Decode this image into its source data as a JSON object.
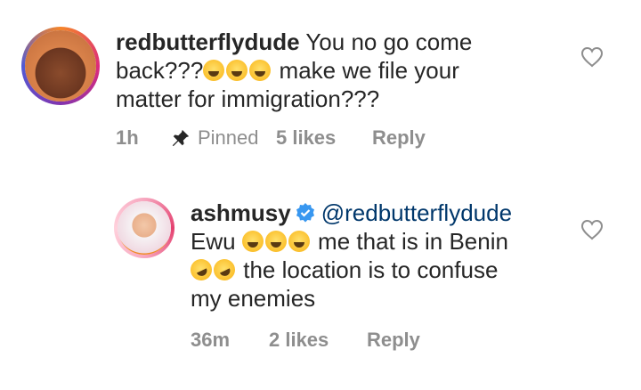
{
  "comments": [
    {
      "username": "redbutterflydude",
      "text_line1": "You no go come",
      "text_line2a": "back???",
      "text_line2b": "make we file your",
      "text_line3": "matter for immigration???",
      "time": "1h",
      "pinned": "Pinned",
      "likes": "5 likes",
      "reply": "Reply"
    },
    {
      "username": "ashmusy",
      "verified": true,
      "mention": "@redbutterflydude",
      "text_a": "Ewu",
      "text_b": "me that is in Benin",
      "text_c": "the location is to confuse",
      "text_d": "my enemies",
      "time": "36m",
      "likes": "2 likes",
      "reply": "Reply"
    }
  ],
  "colors": {
    "text": "#262626",
    "meta": "#8e8e8e",
    "mention": "#00376b",
    "verified": "#3897f0"
  },
  "icons": [
    "heart-icon",
    "pin-icon",
    "verified-badge-icon",
    "laughing-emoji-icon",
    "rolling-laughing-emoji-icon"
  ]
}
